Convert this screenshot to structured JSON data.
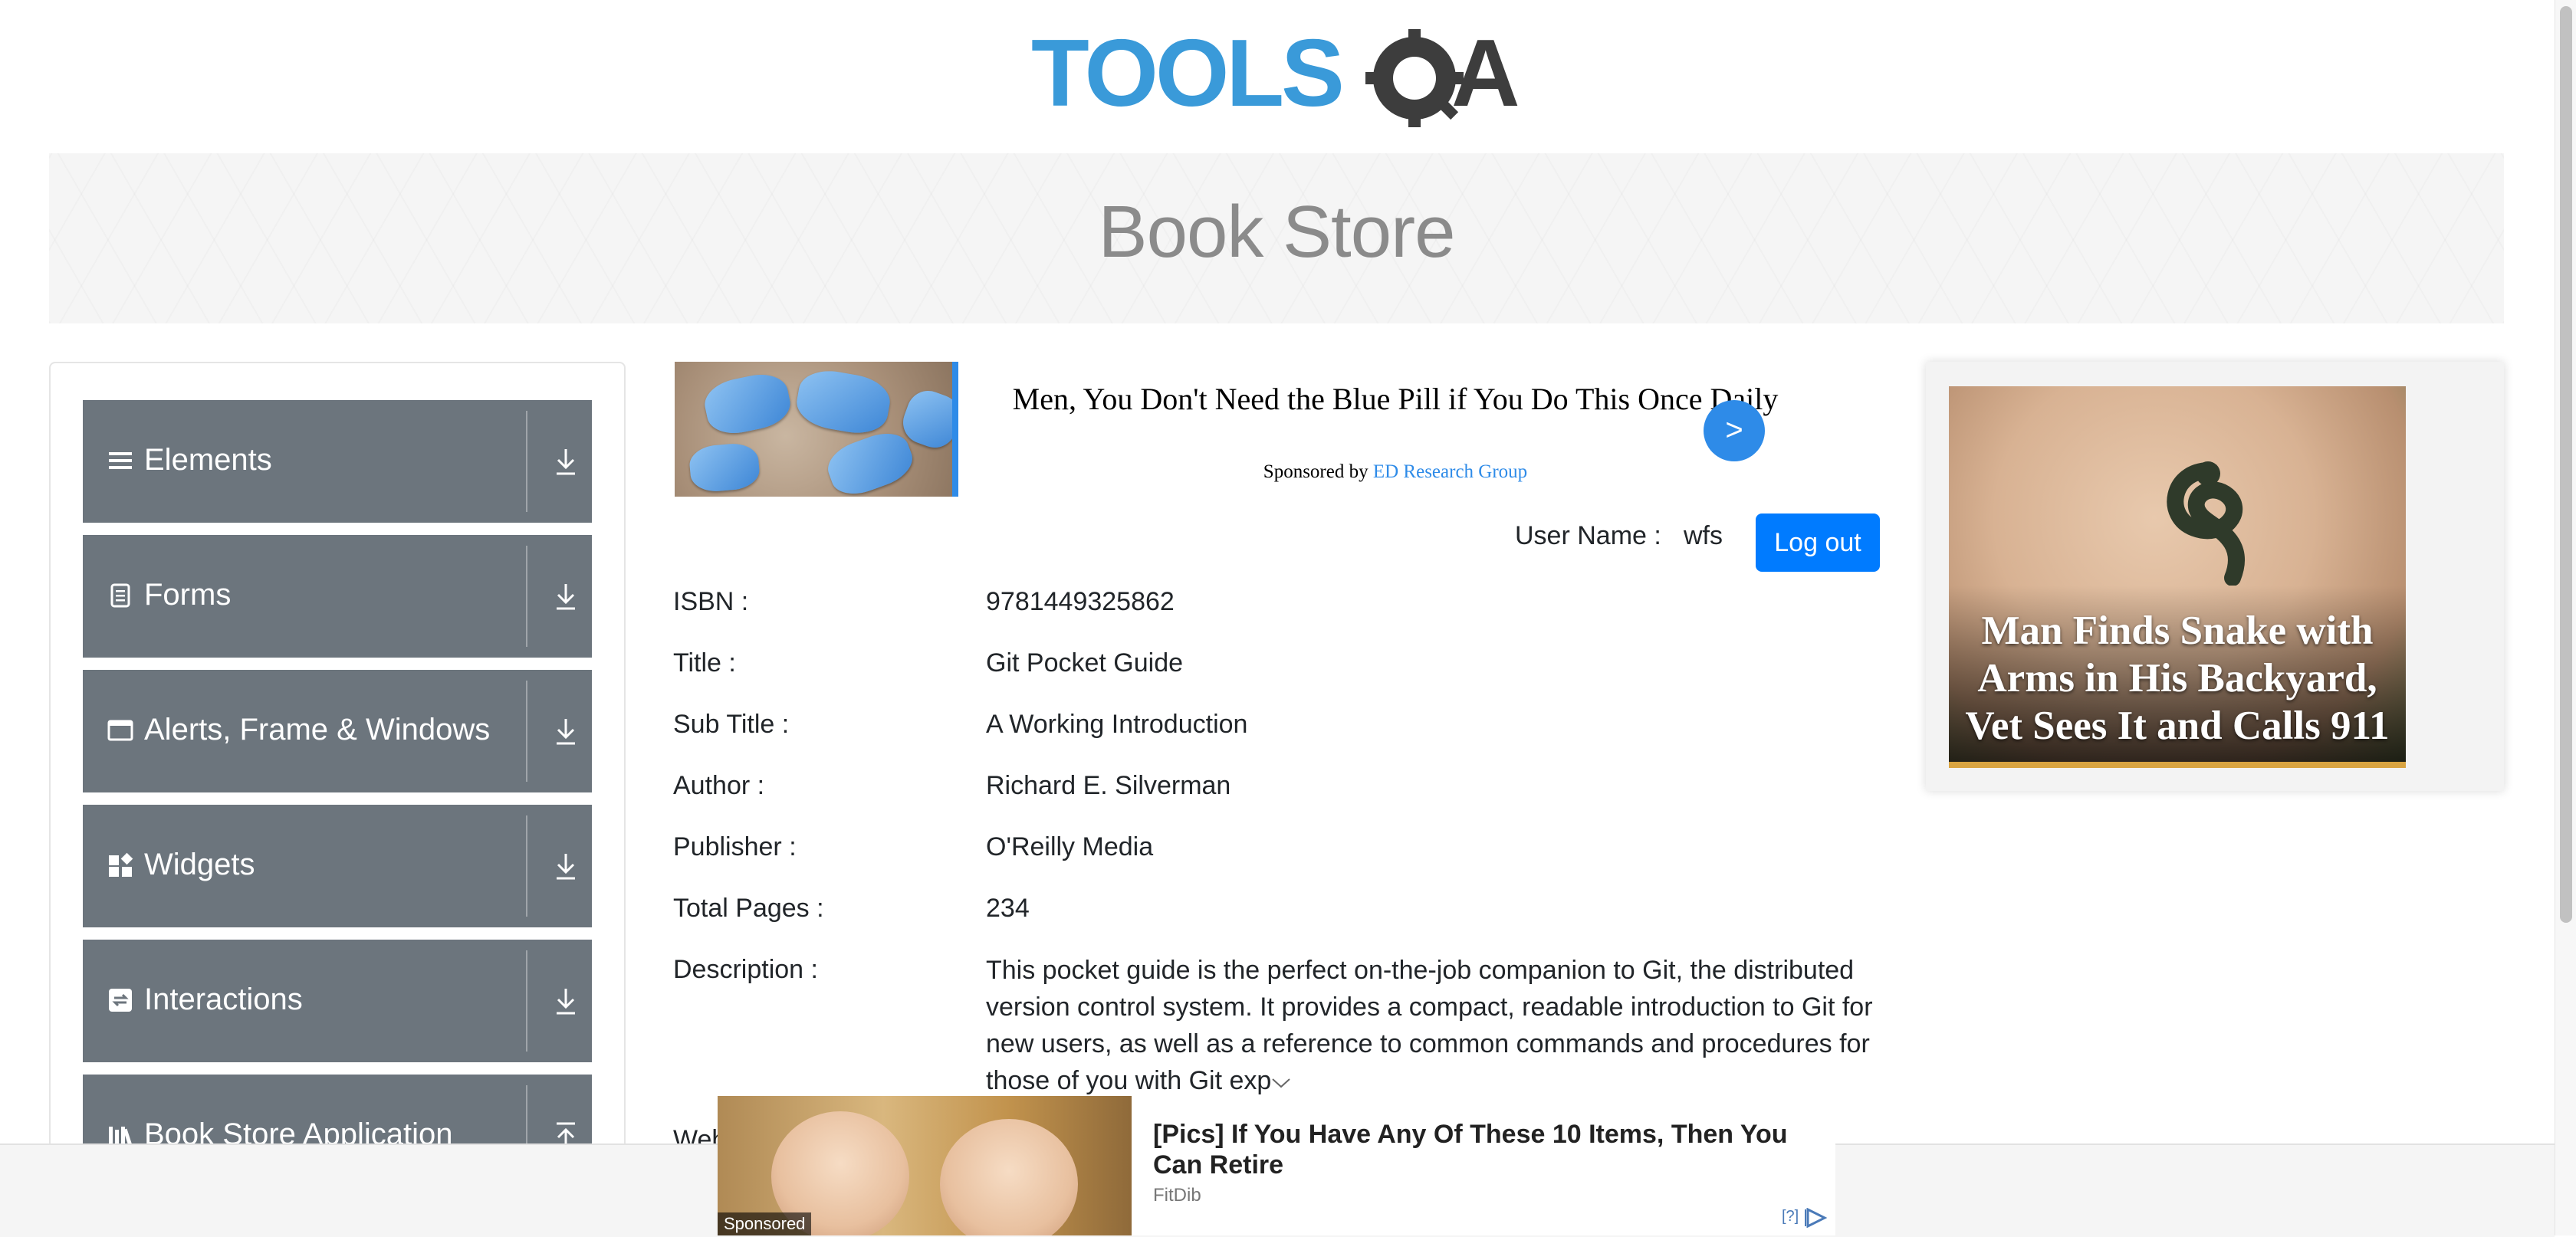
{
  "header": {
    "logo_text": "TOOLSQA"
  },
  "banner": {
    "title": "Book Store"
  },
  "sidebar": {
    "groups": [
      {
        "label": "Elements",
        "icon": "hamburger-icon"
      },
      {
        "label": "Forms",
        "icon": "document-icon"
      },
      {
        "label": "Alerts, Frame & Windows",
        "icon": "window-icon"
      },
      {
        "label": "Widgets",
        "icon": "widgets-icon"
      },
      {
        "label": "Interactions",
        "icon": "interactions-icon"
      },
      {
        "label": "Book Store Application",
        "icon": "library-icon"
      }
    ]
  },
  "ad_top": {
    "headline": "Men, You Don't Need the Blue Pill if You Do This Once Daily",
    "sponsored_prefix": "Sponsored by",
    "sponsor": "ED Research Group",
    "go_label": ">"
  },
  "user": {
    "label": "User Name :",
    "name": "wfs",
    "logout_label": "Log out"
  },
  "book": {
    "fields": [
      {
        "label": "ISBN :",
        "value": "9781449325862"
      },
      {
        "label": "Title :",
        "value": "Git Pocket Guide"
      },
      {
        "label": "Sub Title :",
        "value": "A Working Introduction"
      },
      {
        "label": "Author :",
        "value": "Richard E. Silverman"
      },
      {
        "label": "Publisher :",
        "value": "O'Reilly Media"
      },
      {
        "label": "Total Pages :",
        "value": "234"
      }
    ],
    "description_label": "Description :",
    "description": "This pocket guide is the perfect on-the-job companion to Git, the distributed version control system. It provides a compact, readable introduction to Git for new users, as well as a reference to common commands and procedures for those of you with Git exp",
    "website_label": "Website :"
  },
  "ad_right": {
    "headline": "Man Finds Snake with Arms in His Backyard, Vet Sees It and Calls 911"
  },
  "ad_bottom": {
    "headline": "[Pics] If You Have Any Of These 10 Items, Then You Can Retire",
    "source": "FitDib",
    "sponsored": "Sponsored",
    "info": "[?]"
  },
  "colors": {
    "sidebar_group_bg": "#6c757d",
    "primary_button": "#007bff",
    "ad_accent": "#2e8be8",
    "logo_blue": "#3a9ad9",
    "logo_dark": "#3d3d3d"
  }
}
